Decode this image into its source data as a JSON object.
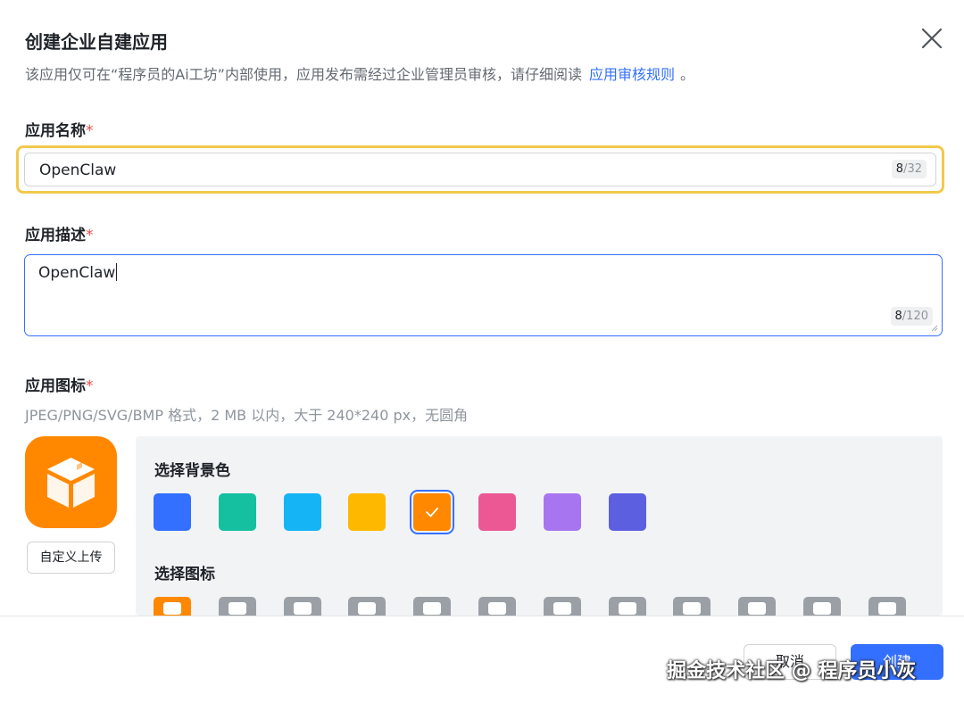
{
  "dialog": {
    "title": "创建企业自建应用",
    "subtitle": "该应用仅可在“程序员的Ai工坊”内部使用，应用发布需经过企业管理员审核，请仔细阅读",
    "rules_link": "应用审核规则",
    "subtitle_end": "。"
  },
  "name_field": {
    "label": "应用名称",
    "required_mark": "*",
    "value": "OpenClaw",
    "count_current": "8",
    "count_max": "/32"
  },
  "desc_field": {
    "label": "应用描述",
    "required_mark": "*",
    "value": "OpenClaw",
    "count_current": "8",
    "count_max": "/120"
  },
  "icon_field": {
    "label": "应用图标",
    "required_mark": "*",
    "hint": "JPEG/PNG/SVG/BMP 格式，2 MB 以内，大于 240*240 px，无圆角",
    "preview_color": "#ff8800",
    "preview_icon": "cube-icon",
    "upload_label": "自定义上传"
  },
  "picker": {
    "bg_title": "选择背景色",
    "colors": [
      "#3370ff",
      "#14c0a0",
      "#14b4f5",
      "#ffb800",
      "#ff8800",
      "#eb5894",
      "#a875f0",
      "#5b5fe0"
    ],
    "selected_color_index": 4,
    "icon_title": "选择图标",
    "icons": [
      "cube-icon",
      "robot-icon",
      "compass-icon",
      "book-icon",
      "briefcase-icon",
      "home-icon",
      "checkbox-icon",
      "pie-icon",
      "star-icon",
      "tag-icon",
      "wrench-icon",
      "document-icon"
    ],
    "selected_icon_index": 0
  },
  "footer": {
    "cancel_label": "取消",
    "create_label": "创建"
  },
  "watermark": "掘金技术社区 @ 程序员小灰"
}
